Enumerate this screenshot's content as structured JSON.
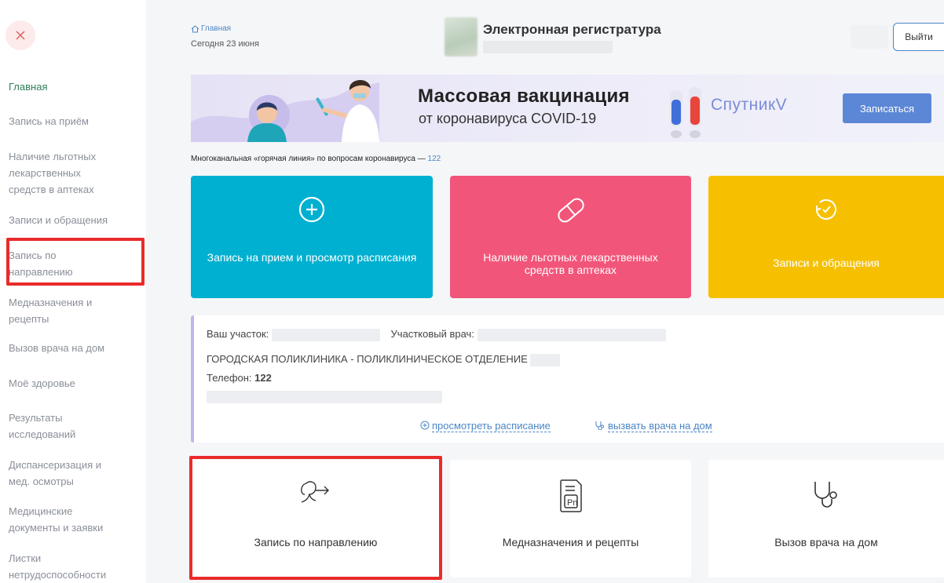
{
  "sidebar": {
    "items": [
      {
        "label": "Главная"
      },
      {
        "label": "Запись на приём"
      },
      {
        "label": "Наличие льготных лекарственных средств в аптеках"
      },
      {
        "label": "Записи и обращения"
      },
      {
        "label": "Запись по направлению"
      },
      {
        "label": "Медназначения и рецепты"
      },
      {
        "label": "Вызов врача на дом"
      },
      {
        "label": "Моё здоровье"
      },
      {
        "label": "Результаты исследований"
      },
      {
        "label": "Диспансеризация и мед. осмотры"
      },
      {
        "label": "Медицинские документы и заявки"
      },
      {
        "label": "Листки нетрудоспособности"
      }
    ]
  },
  "header": {
    "breadcrumb": "Главная",
    "today": "Сегодня 23 июня",
    "title": "Электронная регистратура",
    "logout": "Выйти"
  },
  "banner": {
    "title": "Массовая вакцинация",
    "subtitle": "от коронавируса COVID-19",
    "brand": "СпутникV",
    "button": "Записаться"
  },
  "hotline": {
    "text": "Многоканальная «горячая линия» по вопросам коронавируса — ",
    "number": "122"
  },
  "tiles": [
    {
      "label": "Запись на прием и просмотр расписания",
      "color": "#00b0d0"
    },
    {
      "label": "Наличие льготных лекарственных средств в аптеках",
      "color": "#f2557a"
    },
    {
      "label": "Записи и обращения",
      "color": "#f6c000"
    }
  ],
  "info": {
    "district_label": "Ваш участок:",
    "doctor_label": "Участковый врач:",
    "clinic": "ГОРОДСКАЯ ПОЛИКЛИНИКА - ПОЛИКЛИНИЧЕСКОЕ ОТДЕЛЕНИЕ",
    "phone_label": "Телефон:",
    "phone": "122",
    "link_schedule": "просмотреть расписание",
    "link_call": "вызвать врача на дом"
  },
  "cards": [
    {
      "label": "Запись по направлению",
      "icon": "referral-icon"
    },
    {
      "label": "Медназначения и рецепты",
      "icon": "prescription-icon"
    },
    {
      "label": "Вызов врача на дом",
      "icon": "stethoscope-icon"
    }
  ]
}
